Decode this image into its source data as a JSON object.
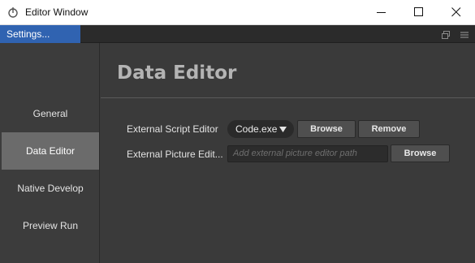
{
  "window": {
    "title": "Editor Window",
    "icons": {
      "app": "app-logo-icon",
      "minimize": "minimize-icon",
      "maximize": "maximize-icon",
      "close": "close-icon"
    }
  },
  "tabbar": {
    "active_tab": "Settings...",
    "icons": [
      "restore-window-icon",
      "menu-icon"
    ]
  },
  "sidebar": {
    "items": [
      {
        "label": "General",
        "active": false
      },
      {
        "label": "Data Editor",
        "active": true
      },
      {
        "label": "Native Develop",
        "active": false
      },
      {
        "label": "Preview Run",
        "active": false
      }
    ]
  },
  "main": {
    "title": "Data Editor",
    "script_editor": {
      "label": "External Script Editor",
      "selected": "Code.exe",
      "browse_label": "Browse",
      "remove_label": "Remove"
    },
    "picture_editor": {
      "label": "External Picture Edit...",
      "value": "",
      "placeholder": "Add external picture editor path",
      "browse_label": "Browse"
    }
  },
  "colors": {
    "accent_tab": "#3063b1",
    "background": "#3a3a3a",
    "sidebar_active": "#6b6b6b"
  }
}
